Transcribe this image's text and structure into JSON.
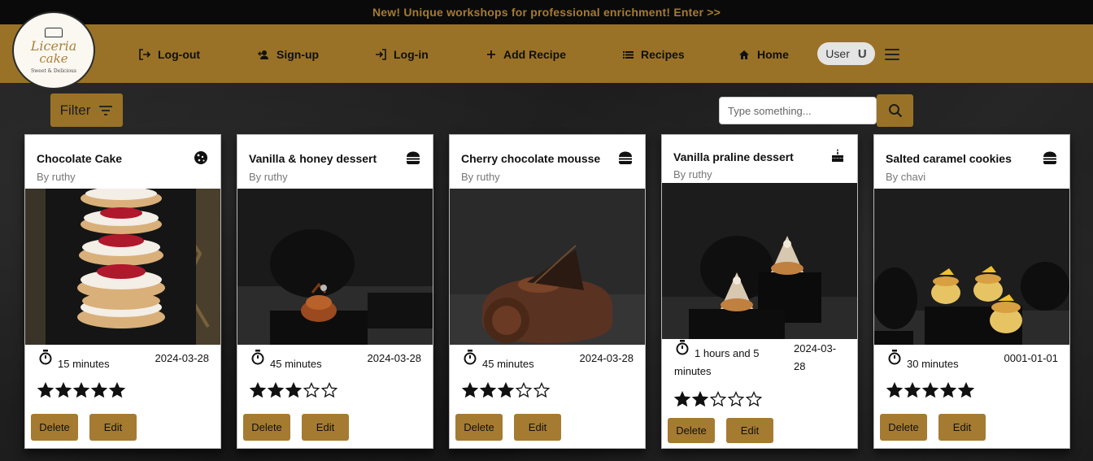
{
  "announcement": "New! Unique workshops for professional enrichment! Enter >>",
  "logo": {
    "line1": "Liceria",
    "line2": "cake",
    "tagline": "Sweet & Delicious"
  },
  "nav": {
    "logout": "Log-out",
    "signup": "Sign-up",
    "login": "Log-in",
    "add_recipe": "Add Recipe",
    "recipes": "Recipes",
    "home": "Home"
  },
  "user": {
    "label": "User",
    "initial": "U"
  },
  "filter": {
    "label": "Filter"
  },
  "search": {
    "placeholder": "Type something..."
  },
  "colors": {
    "brand": "#9a7227",
    "button": "#a57b32",
    "announce_text": "#a57b32"
  },
  "recipes": [
    {
      "title": "Chocolate Cake",
      "author": "By ruthy",
      "category_icon": "cookie-icon",
      "time": "15 minutes",
      "date": "2024-03-28",
      "rating": 5,
      "delete": "Delete",
      "edit": "Edit"
    },
    {
      "title": "Vanilla & honey dessert",
      "author": "By ruthy",
      "category_icon": "burger-icon",
      "time": "45 minutes",
      "date": "2024-03-28",
      "rating": 3,
      "delete": "Delete",
      "edit": "Edit"
    },
    {
      "title": "Cherry chocolate mousse",
      "author": "By ruthy",
      "category_icon": "burger-icon",
      "time": "45 minutes",
      "date": "2024-03-28",
      "rating": 3,
      "delete": "Delete",
      "edit": "Edit"
    },
    {
      "title": "Vanilla praline dessert",
      "author": "By ruthy",
      "category_icon": "birthday-cake-icon",
      "time_line1": "1 hours and 5",
      "time_line2": "minutes",
      "date_line1": "2024-03-",
      "date_line2": "28",
      "rating": 2,
      "delete": "Delete",
      "edit": "Edit"
    },
    {
      "title": "Salted caramel cookies",
      "author": "By chavi",
      "category_icon": "burger-icon",
      "time": "30 minutes",
      "date": "0001-01-01",
      "rating": 5,
      "delete": "Delete",
      "edit": "Edit"
    }
  ]
}
